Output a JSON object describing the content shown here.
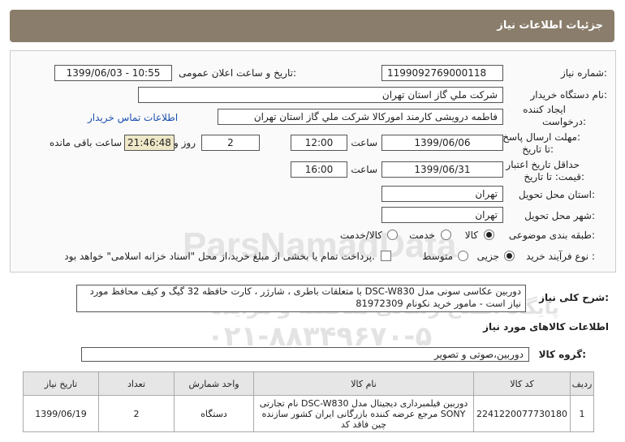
{
  "header": {
    "title": "جزئیات اطلاعات نیاز"
  },
  "fields": {
    "need_number_label": "شماره نیاز:",
    "need_number": "1199092769000118",
    "announce_label": "تاریخ و ساعت اعلان عمومی:",
    "announce_value": "1399/06/03 - 10:55",
    "buyer_org_label": "نام دستگاه خریدار:",
    "buyer_org": "شرکت ملي گاز استان تهران",
    "creator_label_1": "ایجاد کننده",
    "creator_label_2": "درخواست:",
    "creator": "فاطمه درویشی کارمند امورکالا شرکت ملي گاز استان تهران",
    "contact_link": "اطلاعات تماس خریدار",
    "deadline_label_1": "مهلت ارسال پاسخ:",
    "deadline_label_2": "تا تاریخ:",
    "deadline_date": "1399/06/06",
    "time_label": "ساعت",
    "deadline_time": "12:00",
    "days_value": "2",
    "days_label": "روز و",
    "remaining_time": "21:46:48",
    "remaining_label": "ساعت باقی مانده",
    "validity_label_1": "حداقل تاریخ اعتبار",
    "validity_label_2": "قیمت: تا تاریخ:",
    "validity_date": "1399/06/31",
    "validity_time": "16:00",
    "province_label": "استان محل تحویل:",
    "province": "تهران",
    "city_label": "شهر محل تحویل:",
    "city": "تهران",
    "category_label": "طبقه بندی موضوعی:",
    "category_options": [
      "کالا",
      "خدمت",
      "کالا/خدمت"
    ],
    "process_label": "نوع فرآیند خرید :",
    "process_options": [
      "جزیی",
      "متوسط"
    ],
    "payment_note": "پرداخت تمام یا بخشی از مبلغ خرید،از محل \"اسناد خزانه اسلامی\" خواهد بود."
  },
  "description": {
    "label": "شرح کلی نیاز:",
    "text": "دوربین عکاسی سونی مدل DSC-W830 با متعلقات باطری ، شارژر ، کارت حافظه 32 گیگ و کیف محافظ مورد نیاز است - مامور خرید نکونام 81972309"
  },
  "goods_info_title": "اطلاعات کالاهای مورد نیاز",
  "goods_group": {
    "label": "گروه کالا:",
    "value": "دوربین،صوتی و تصویر"
  },
  "table": {
    "headers": [
      "ردیف",
      "کد کالا",
      "نام کالا",
      "واحد شمارش",
      "تعداد",
      "تاریخ نیاز"
    ],
    "rows": [
      [
        "1",
        "2241220077730180",
        "دوربین فیلمبرداری دیجیتال مدل DSC-W830 نام تجارتی SONY مرجع عرضه کننده بازرگانی ایران کشور سازنده چین فاقد کد",
        "دستگاه",
        "2",
        "1399/06/19"
      ]
    ]
  },
  "watermark": {
    "line1": "ParsNamadData",
    "line2": "پایگاه اطلاع رسانی مناقصه و مزایده",
    "line3": "۰۲۱-۸۸۳۴۹۶۷۰-۵"
  },
  "colors": {
    "header_bg": "#8a7d6b",
    "remaining_bg": "#eee8c8",
    "link": "#1a4fb0"
  }
}
